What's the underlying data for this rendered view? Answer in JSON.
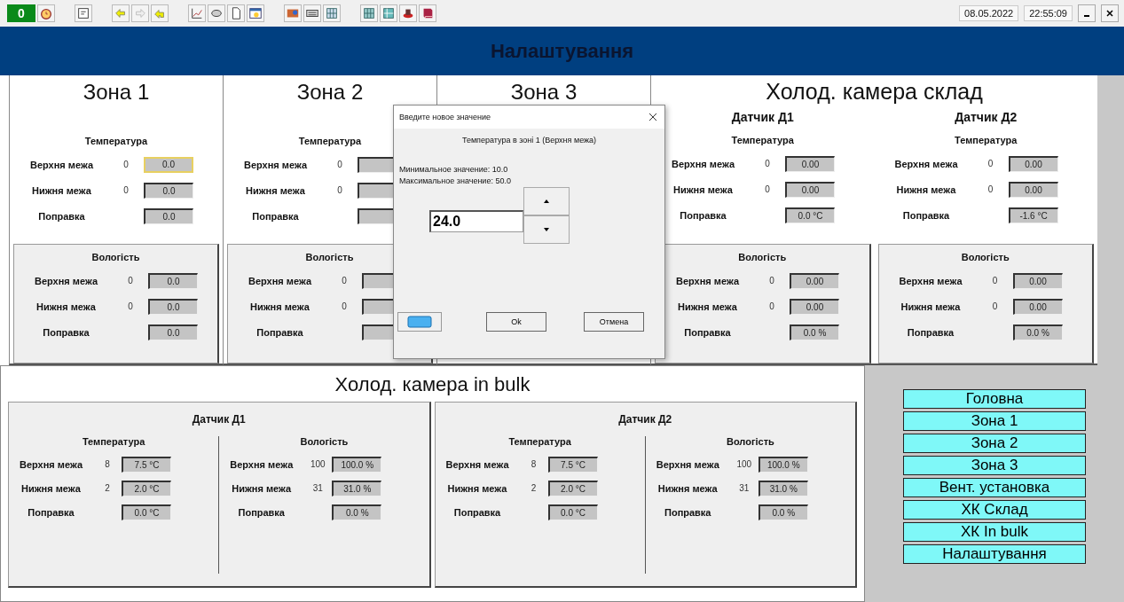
{
  "toolbar": {
    "counter": "0",
    "date": "08.05.2022",
    "time": "22:55:09"
  },
  "header": {
    "title": "Налаштування"
  },
  "zones": [
    {
      "title": "Зона 1",
      "temperature": {
        "heading": "Температура",
        "rows": [
          {
            "label": "Верхня межа",
            "reading": "0",
            "value": "0.0",
            "focused": true
          },
          {
            "label": "Нижня межа",
            "reading": "0",
            "value": "0.0",
            "focused": false
          },
          {
            "label": "Поправка",
            "value": "0.0",
            "focused": false
          }
        ]
      },
      "humidity": {
        "heading": "Вологість",
        "rows": [
          {
            "label": "Верхня межа",
            "reading": "0",
            "value": "0.0",
            "focused": false
          },
          {
            "label": "Нижня межа",
            "reading": "0",
            "value": "0.0",
            "focused": false
          },
          {
            "label": "Поправка",
            "value": "0.0",
            "focused": false
          }
        ]
      }
    },
    {
      "title": "Зона 2",
      "temperature": {
        "heading": "Температура",
        "rows": [
          {
            "label": "Верхня межа",
            "reading": "0",
            "focused": false
          },
          {
            "label": "Нижня межа",
            "reading": "0",
            "focused": false
          },
          {
            "label": "Поправка",
            "focused": false
          }
        ]
      },
      "humidity": {
        "heading": "Вологість",
        "rows": [
          {
            "label": "Верхня межа",
            "reading": "0",
            "focused": false
          },
          {
            "label": "Нижня межа",
            "reading": "0",
            "focused": false
          },
          {
            "label": "Поправка",
            "focused": false
          }
        ]
      }
    },
    {
      "title": "Зона 3"
    }
  ],
  "cold_store": {
    "title": "Холод. камера склад",
    "sensors": [
      {
        "title": "Датчик Д1",
        "temperature": {
          "heading": "Температура",
          "rows": [
            {
              "label": "Верхня межа",
              "reading": "0",
              "value": "0.00"
            },
            {
              "label": "Нижня межа",
              "reading": "0",
              "value": "0.00"
            },
            {
              "label": "Поправка",
              "value": "0.0 °C"
            }
          ]
        },
        "humidity": {
          "heading": "Вологість",
          "rows": [
            {
              "label": "Верхня межа",
              "reading": "0",
              "value": "0.00"
            },
            {
              "label": "Нижня межа",
              "reading": "0",
              "value": "0.00"
            },
            {
              "label": "Поправка",
              "value": "0.0 %"
            }
          ]
        }
      },
      {
        "title": "Датчик Д2",
        "temperature": {
          "heading": "Температура",
          "rows": [
            {
              "label": "Верхня межа",
              "reading": "0",
              "value": "0.00"
            },
            {
              "label": "Нижня межа",
              "reading": "0",
              "value": "0.00"
            },
            {
              "label": "Поправка",
              "value": "-1.6 °C"
            }
          ]
        },
        "humidity": {
          "heading": "Вологість",
          "rows": [
            {
              "label": "Верхня межа",
              "reading": "0",
              "value": "0.00"
            },
            {
              "label": "Нижня межа",
              "reading": "0",
              "value": "0.00"
            },
            {
              "label": "Поправка",
              "value": "0.0 %"
            }
          ]
        }
      }
    ]
  },
  "cold_bulk": {
    "title": "Холод. камера in bulk",
    "sensors": [
      {
        "title": "Датчик Д1",
        "temperature": {
          "heading": "Температура",
          "rows": [
            {
              "label": "Верхня межа",
              "reading": "8",
              "value": "7.5 °C"
            },
            {
              "label": "Нижня межа",
              "reading": "2",
              "value": "2.0 °C"
            },
            {
              "label": "Поправка",
              "value": "0.0 °C"
            }
          ]
        },
        "humidity": {
          "heading": "Вологість",
          "rows": [
            {
              "label": "Верхня межа",
              "reading": "100",
              "value": "100.0 %"
            },
            {
              "label": "Нижня межа",
              "reading": "31",
              "value": "31.0 %"
            },
            {
              "label": "Поправка",
              "value": "0.0 %"
            }
          ]
        }
      },
      {
        "title": "Датчик Д2",
        "temperature": {
          "heading": "Температура",
          "rows": [
            {
              "label": "Верхня межа",
              "reading": "8",
              "value": "7.5 °C"
            },
            {
              "label": "Нижня межа",
              "reading": "2",
              "value": "2.0 °C"
            },
            {
              "label": "Поправка",
              "value": "0.0 °C"
            }
          ]
        },
        "humidity": {
          "heading": "Вологість",
          "rows": [
            {
              "label": "Верхня межа",
              "reading": "100",
              "value": "100.0 %"
            },
            {
              "label": "Нижня межа",
              "reading": "31",
              "value": "31.0 %"
            },
            {
              "label": "Поправка",
              "value": "0.0 %"
            }
          ]
        }
      }
    ]
  },
  "navigation": [
    "Головна",
    "Зона 1",
    "Зона 2",
    "Зона 3",
    "Вент. установка",
    "ХК Склад",
    "ХК In bulk",
    "Налаштування"
  ],
  "dialog": {
    "title": "Введите новое значение",
    "subtitle": "Температура в зоні 1 (Верхня межа)",
    "min_text": "Минимальное значение: 10.0",
    "max_text": "Максимальное значение: 50.0",
    "value": "24.0",
    "ok": "Ok",
    "cancel": "Отмена"
  }
}
